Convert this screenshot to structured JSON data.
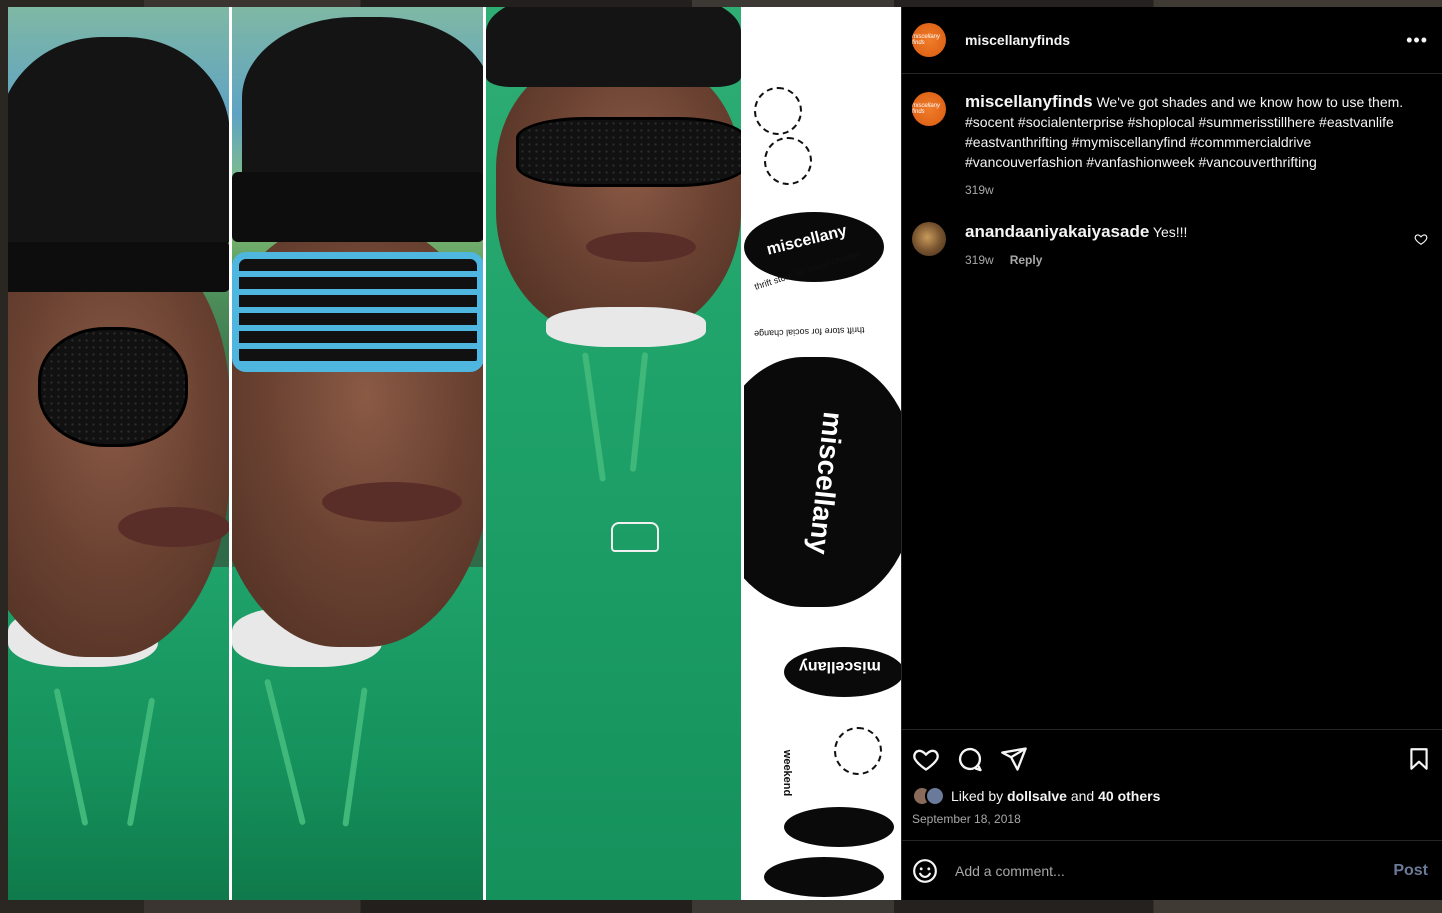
{
  "post": {
    "account": "miscellanyfinds",
    "avatar_text": "miscellany finds",
    "caption": "We've got shades and we know how to use them. #socent #socialenterprise #shoplocal #summerisstillhere #eastvanlife #eastvanthrifting #mymiscellanyfind #commmercialdrive #vancouverfashion #vanfashionweek #vancouverthrifting",
    "caption_age": "319w",
    "liked_by_prefix": "Liked by",
    "liked_by_user": "dollsalve",
    "liked_by_and": "and",
    "liked_by_others": "40 others",
    "date": "September 18, 2018"
  },
  "header": {
    "more_label": "•••"
  },
  "comments": [
    {
      "username": "anandaaniyakaiyasade",
      "text": "Yes!!!",
      "age": "319w",
      "reply_label": "Reply"
    }
  ],
  "image": {
    "logo_word": "miscellany",
    "tagline": "thrift store for social change",
    "weekend_word": "weekend"
  },
  "composer": {
    "placeholder": "Add a comment...",
    "post_label": "Post"
  },
  "icons": {
    "like": "heart-icon",
    "comment": "comment-bubble-icon",
    "share": "paper-plane-icon",
    "save": "bookmark-icon",
    "emoji": "smiley-icon",
    "more": "more-horizontal-icon"
  },
  "colors": {
    "background": "#000000",
    "text": "#f5f5f5",
    "muted": "#a8a8a8",
    "post_button": "#6b7a99",
    "avatar": "#e06418",
    "hoodie": "#1fa36a",
    "blue_shades": "#4fb6e0"
  }
}
